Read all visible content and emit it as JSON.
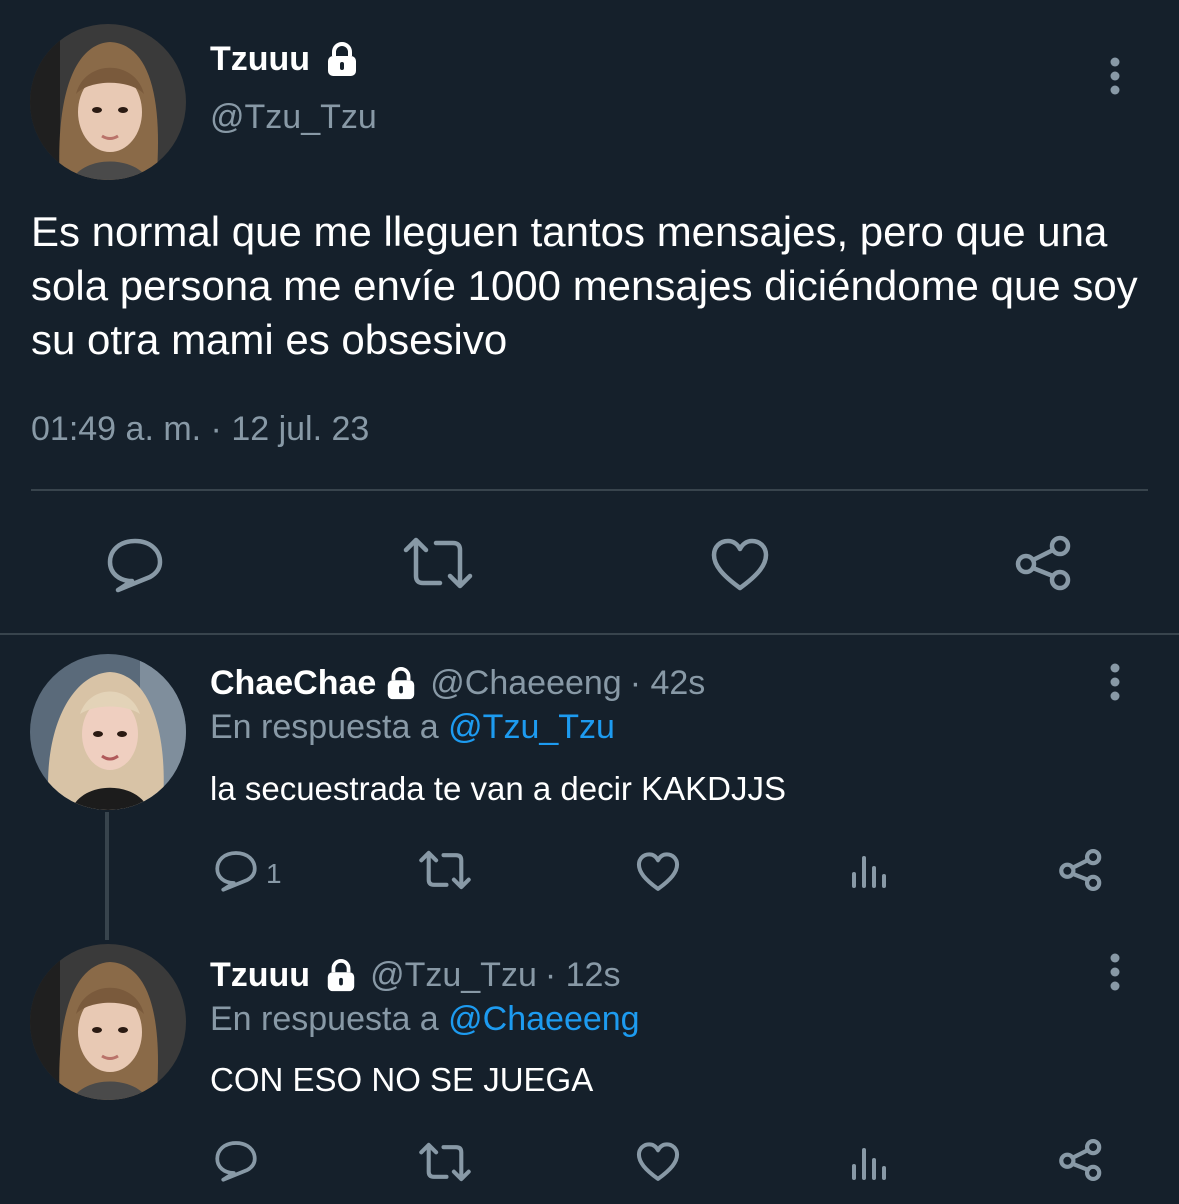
{
  "main_tweet": {
    "author_name": "Tzuuu",
    "author_handle": "@Tzu_Tzu",
    "text": "Es normal que me lleguen tantos mensajes, pero que una sola persona me envíe 1000 mensajes diciéndome que soy su otra mami es obsesivo",
    "timestamp": "01:49 a. m. · 12 jul. 23",
    "icons": [
      "reply-icon",
      "retweet-icon",
      "like-icon",
      "share-icon"
    ]
  },
  "replies": [
    {
      "author_name": "ChaeChae",
      "author_handle": "@Chaeeeng",
      "age": "· 42s",
      "reply_prefix": "En respuesta a",
      "reply_to": "@Tzu_Tzu",
      "text": "la secuestrada te van a decir KAKDJJS",
      "reply_count": "1"
    },
    {
      "author_name": "Tzuuu",
      "author_handle": "@Tzu_Tzu",
      "age": "· 12s",
      "reply_prefix": "En respuesta a",
      "reply_to": "@Chaeeeng",
      "text": "CON ESO NO SE JUEGA",
      "reply_count": ""
    }
  ],
  "colors": {
    "background": "#15202b",
    "muted": "#8899a6",
    "link": "#1d9bf0",
    "divider": "#38444d"
  }
}
